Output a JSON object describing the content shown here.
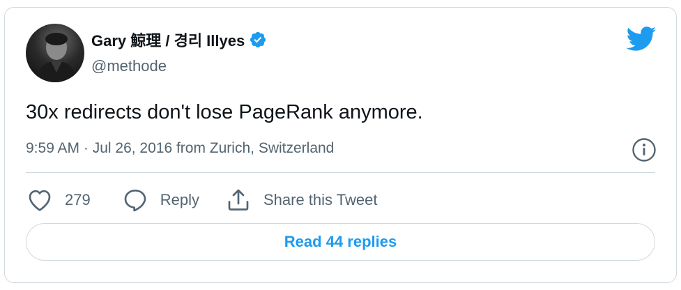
{
  "author": {
    "display_name": "Gary 鯨理 / 경리 Illyes",
    "handle": "@methode",
    "verified": true,
    "avatar_icon": "profile-photo"
  },
  "tweet": {
    "text": "30x redirects don't lose PageRank anymore.",
    "meta": "9:59 AM · Jul 26, 2016 from Zurich, Switzerland"
  },
  "actions": {
    "like_count": "279",
    "reply_label": "Reply",
    "share_label": "Share this Tweet"
  },
  "read_replies_label": "Read 44 replies",
  "colors": {
    "accent": "#1d9bf0",
    "secondary_text": "#536471",
    "border": "#cfd9de"
  },
  "icons": [
    "verified-badge-icon",
    "twitter-bird-icon",
    "info-icon",
    "heart-icon",
    "reply-bubble-icon",
    "share-icon"
  ]
}
